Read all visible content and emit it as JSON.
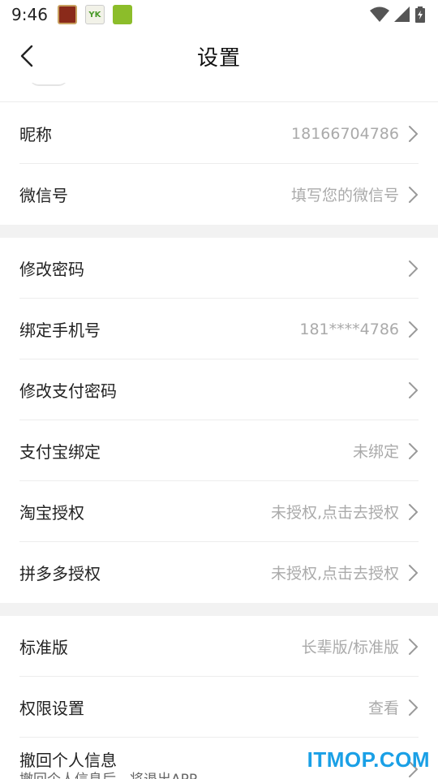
{
  "status_bar": {
    "time": "9:46",
    "notifications": [
      "app-icon-red",
      "app-icon-yk",
      "app-icon-green"
    ],
    "yk_text": "YK"
  },
  "nav": {
    "title": "设置"
  },
  "groups": [
    {
      "rows": [
        {
          "label": "昵称",
          "value": "18166704786"
        },
        {
          "label": "微信号",
          "value": "填写您的微信号"
        }
      ]
    },
    {
      "rows": [
        {
          "label": "修改密码",
          "value": ""
        },
        {
          "label": "绑定手机号",
          "value": "181****4786"
        },
        {
          "label": "修改支付密码",
          "value": ""
        },
        {
          "label": "支付宝绑定",
          "value": "未绑定"
        },
        {
          "label": "淘宝授权",
          "value": "未授权,点击去授权"
        },
        {
          "label": "拼多多授权",
          "value": "未授权,点击去授权"
        }
      ]
    },
    {
      "rows": [
        {
          "label": "标准版",
          "value": "长辈版/标准版"
        },
        {
          "label": "权限设置",
          "value": "查看"
        }
      ],
      "multi_row": {
        "label": "撤回个人信息",
        "sub": "撤回个人信息后，将退出APP"
      }
    }
  ],
  "watermark": "ITMOP.COM",
  "colors": {
    "text": "#222222",
    "value": "#aaaaaa",
    "divider": "#ededed",
    "gap": "#f2f2f2",
    "watermark": "#1aa0e6"
  }
}
